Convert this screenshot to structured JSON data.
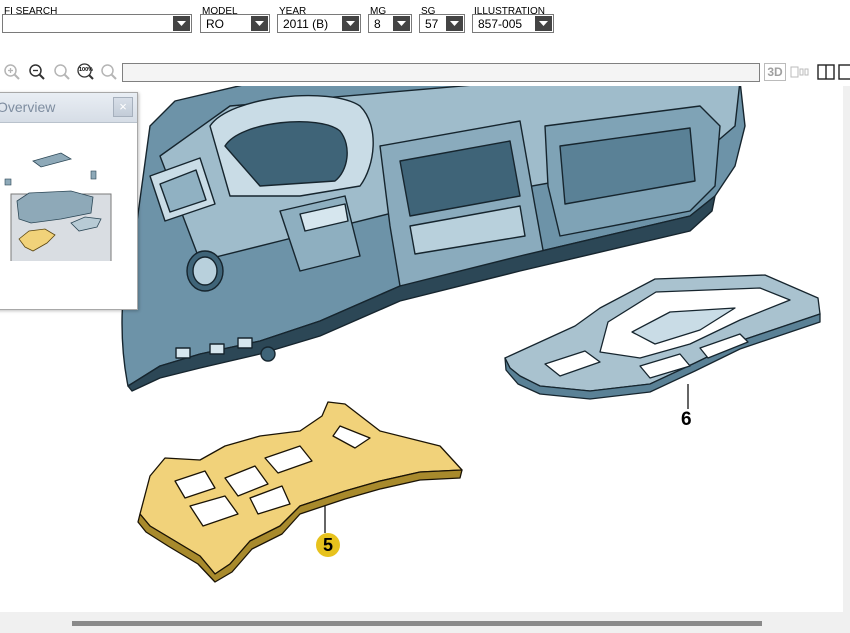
{
  "filters": {
    "fi_search": {
      "label": "FI SEARCH",
      "value": ""
    },
    "model": {
      "label": "MODEL",
      "value": "RO"
    },
    "year": {
      "label": "YEAR",
      "value": "2011 (B)"
    },
    "mg": {
      "label": "MG",
      "value": "8"
    },
    "sg": {
      "label": "SG",
      "value": "57"
    },
    "illustration": {
      "label": "ILLUSTRATION",
      "value": "857-005"
    }
  },
  "toolbar": {
    "zoom_100_label": "100%",
    "view_3d_label": "3D",
    "path_value": ""
  },
  "overview": {
    "title": "Overview",
    "close_glyph": "×"
  },
  "callouts": [
    {
      "id": "5",
      "label": "5",
      "highlighted": true
    },
    {
      "id": "6",
      "label": "6",
      "highlighted": false
    }
  ],
  "colors": {
    "dashboard_fill": "#6d93a8",
    "dashboard_light": "#c9dce6",
    "dashboard_dark": "#3f6478",
    "highlight_fill": "#f1d27a",
    "highlight_badge": "#e7c21d",
    "part6_fill": "#a9c2cf"
  }
}
